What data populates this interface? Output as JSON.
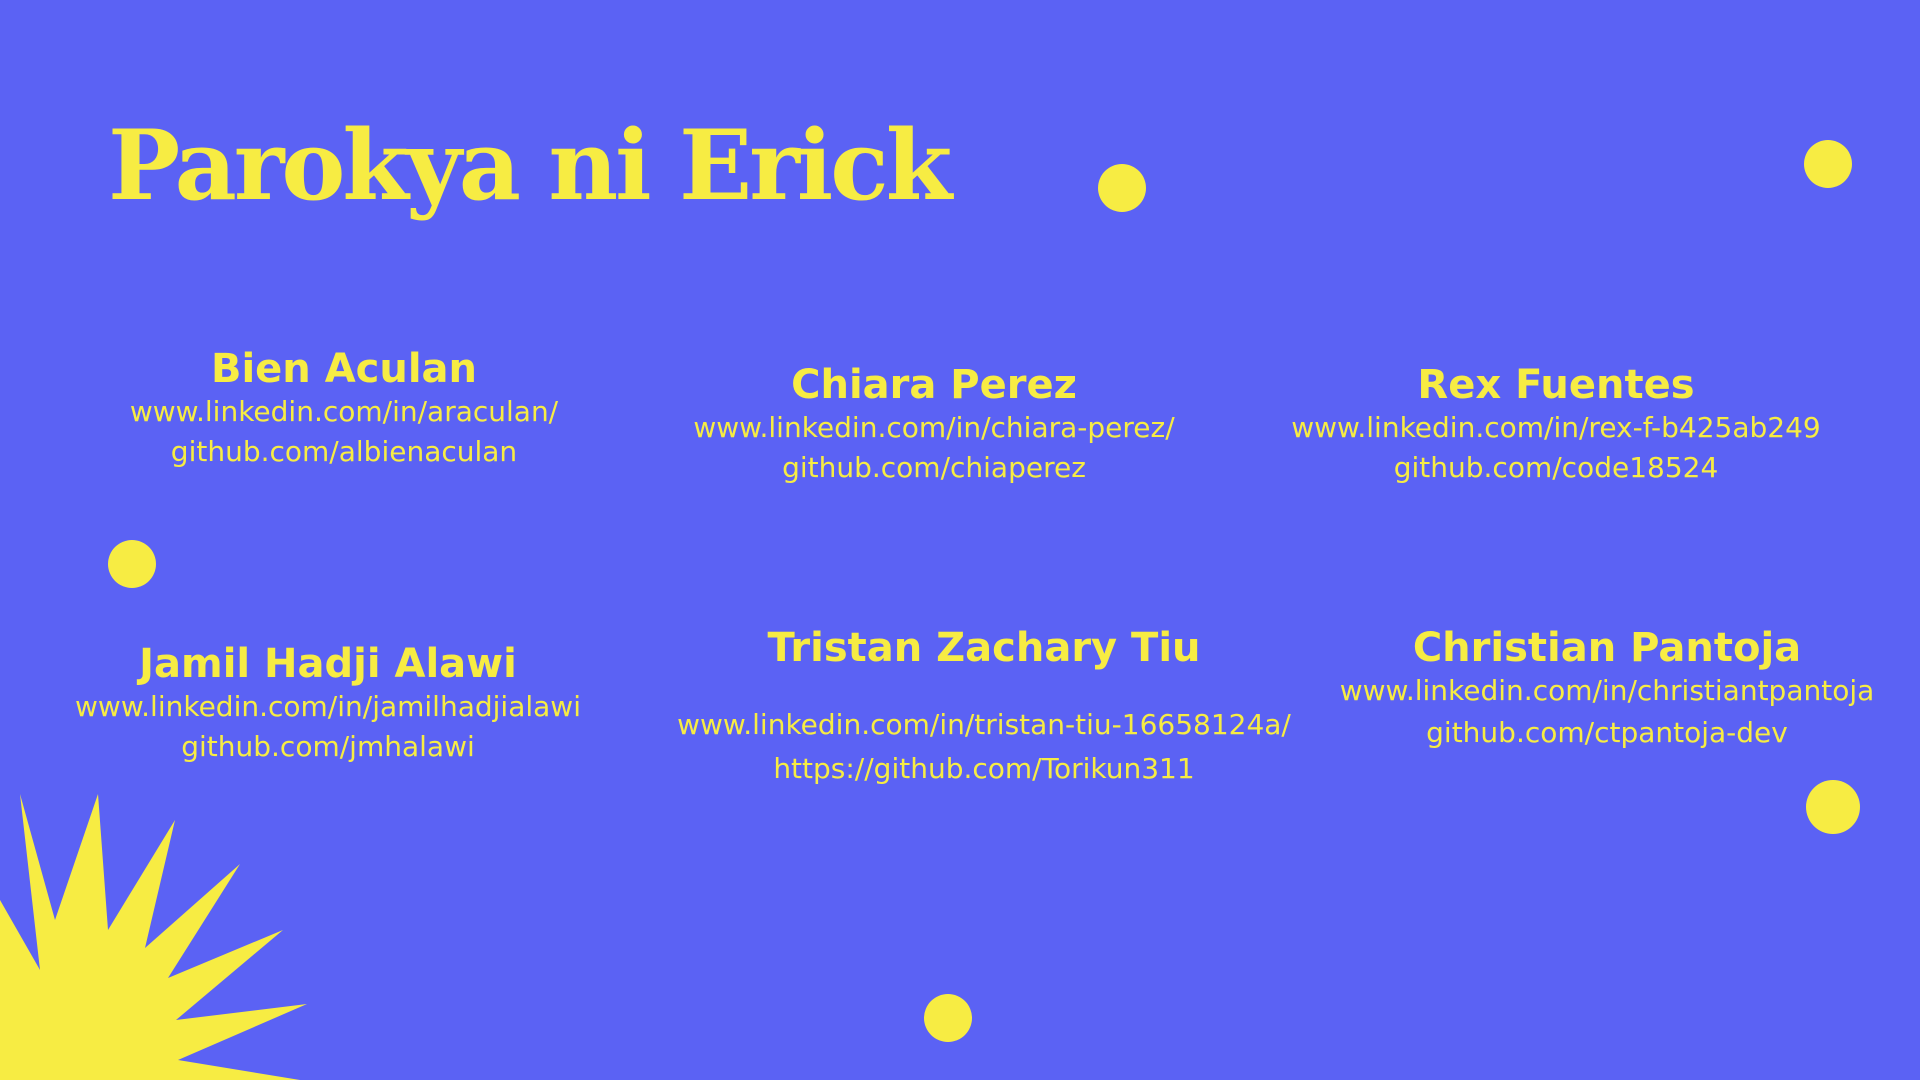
{
  "title": "Parokya ni Erick",
  "accent_color": "#f7ec43",
  "background_color": "#5b62f4",
  "members": [
    {
      "name": "Bien Aculan",
      "linkedin": "www.linkedin.com/in/araculan/",
      "github": "github.com/albienaculan"
    },
    {
      "name": "Chiara Perez",
      "linkedin": "www.linkedin.com/in/chiara-perez/",
      "github": "github.com/chiaperez"
    },
    {
      "name": "Rex Fuentes",
      "linkedin": "www.linkedin.com/in/rex-f-b425ab249",
      "github": "github.com/code18524"
    },
    {
      "name": "Jamil Hadji Alawi",
      "linkedin": "www.linkedin.com/in/jamilhadjialawi",
      "github": "github.com/jmhalawi"
    },
    {
      "name": "Tristan Zachary Tiu",
      "linkedin": "www.linkedin.com/in/tristan-tiu-16658124a/",
      "github": "https://github.com/Torikun311"
    },
    {
      "name": "Christian Pantoja",
      "linkedin": "www.linkedin.com/in/christiantpantoja",
      "github": "github.com/ctpantoja-dev"
    }
  ],
  "decorations": {
    "dots": "yellow-circle",
    "burst": "sunburst-shape"
  }
}
